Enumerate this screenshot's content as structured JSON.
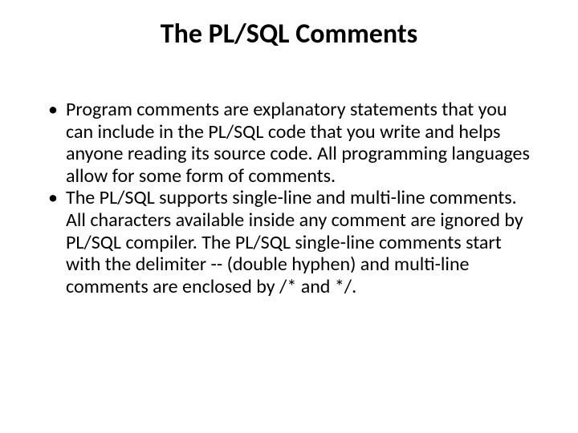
{
  "slide": {
    "title": "The PL/SQL Comments",
    "bullets": [
      "Program comments are explanatory statements that you can include in the PL/SQL code that you write and helps anyone reading its source code. All programming languages allow for some form of comments.",
      "The PL/SQL supports single-line and multi-line comments. All characters available inside any comment are ignored by PL/SQL compiler. The PL/SQL single-line comments start with the delimiter -- (double hyphen) and multi-line comments are enclosed by /* and */."
    ]
  }
}
